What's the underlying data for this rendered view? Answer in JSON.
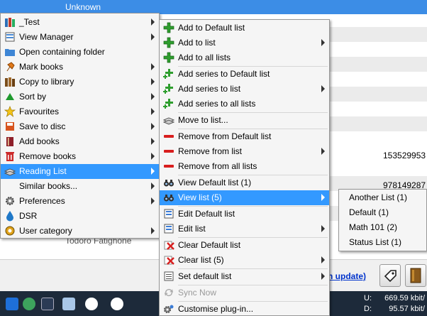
{
  "window": {
    "title": "Unknown"
  },
  "grid": {
    "isbn_1": "153529953",
    "isbn_2": "978149287",
    "author": "Todoro Fatighone"
  },
  "bottom": {
    "link_text": "n update)"
  },
  "taskbar": {
    "up_label": "U:",
    "up_value": "669.59 kbit/",
    "down_label": "D:",
    "down_value": "95.57 kbit/"
  },
  "context_menu": {
    "items": [
      {
        "label": "_Test",
        "icon": "books-icon"
      },
      {
        "label": "View Manager",
        "icon": "view-manager-icon"
      },
      {
        "label": "Open containing folder",
        "icon": "folder-icon"
      },
      {
        "label": "Mark books",
        "icon": "pin-icon"
      },
      {
        "label": "Copy to library",
        "icon": "library-icon"
      },
      {
        "label": "Sort by",
        "icon": "sort-icon"
      },
      {
        "label": "Favourites",
        "icon": "star-icon"
      },
      {
        "label": "Save to disc",
        "icon": "save-icon"
      },
      {
        "label": "Add books",
        "icon": "add-books-icon"
      },
      {
        "label": "Remove books",
        "icon": "trash-icon"
      },
      {
        "label": "Reading List",
        "icon": "reading-list-icon"
      },
      {
        "label": "Similar books...",
        "icon": ""
      },
      {
        "label": "Preferences",
        "icon": "gear-icon"
      },
      {
        "label": "DSR",
        "icon": "drop-icon"
      },
      {
        "label": "User category",
        "icon": "user-category-icon"
      }
    ]
  },
  "reading_list_menu": {
    "items": [
      {
        "label": "Add to Default list",
        "icon": "plus-icon"
      },
      {
        "label": "Add to list",
        "icon": "plus-icon"
      },
      {
        "label": "Add to all lists",
        "icon": "plus-icon"
      },
      {
        "label": "Add series to Default list",
        "icon": "plus-series-icon"
      },
      {
        "label": "Add series to list",
        "icon": "plus-series-icon"
      },
      {
        "label": "Add series to all lists",
        "icon": "plus-series-icon"
      },
      {
        "label": "Move to list...",
        "icon": "move-icon"
      },
      {
        "label": "Remove from Default list",
        "icon": "minus-icon"
      },
      {
        "label": "Remove from list",
        "icon": "minus-icon"
      },
      {
        "label": "Remove from all lists",
        "icon": "minus-icon"
      },
      {
        "label": "View Default list (1)",
        "icon": "binoculars-icon"
      },
      {
        "label": "View list (5)",
        "icon": "binoculars-icon"
      },
      {
        "label": "Edit Default list",
        "icon": "edit-list-icon"
      },
      {
        "label": "Edit list",
        "icon": "edit-list-icon"
      },
      {
        "label": "Clear Default list",
        "icon": "clear-icon"
      },
      {
        "label": "Clear list (5)",
        "icon": "clear-icon"
      },
      {
        "label": "Set default list",
        "icon": "list-icon"
      },
      {
        "label": "Sync Now",
        "icon": "sync-icon"
      },
      {
        "label": "Customise plug-in...",
        "icon": "gear-icon"
      }
    ]
  },
  "view_list_menu": {
    "items": [
      {
        "label": "Another List (1)"
      },
      {
        "label": "Default (1)"
      },
      {
        "label": "Math 101 (2)"
      },
      {
        "label": "Status List (1)"
      }
    ]
  },
  "colors": {
    "highlight": "#3399ff",
    "title_bar": "#3c8de6",
    "plus_green": "#2e9e2e",
    "minus_red": "#d81e1e"
  }
}
